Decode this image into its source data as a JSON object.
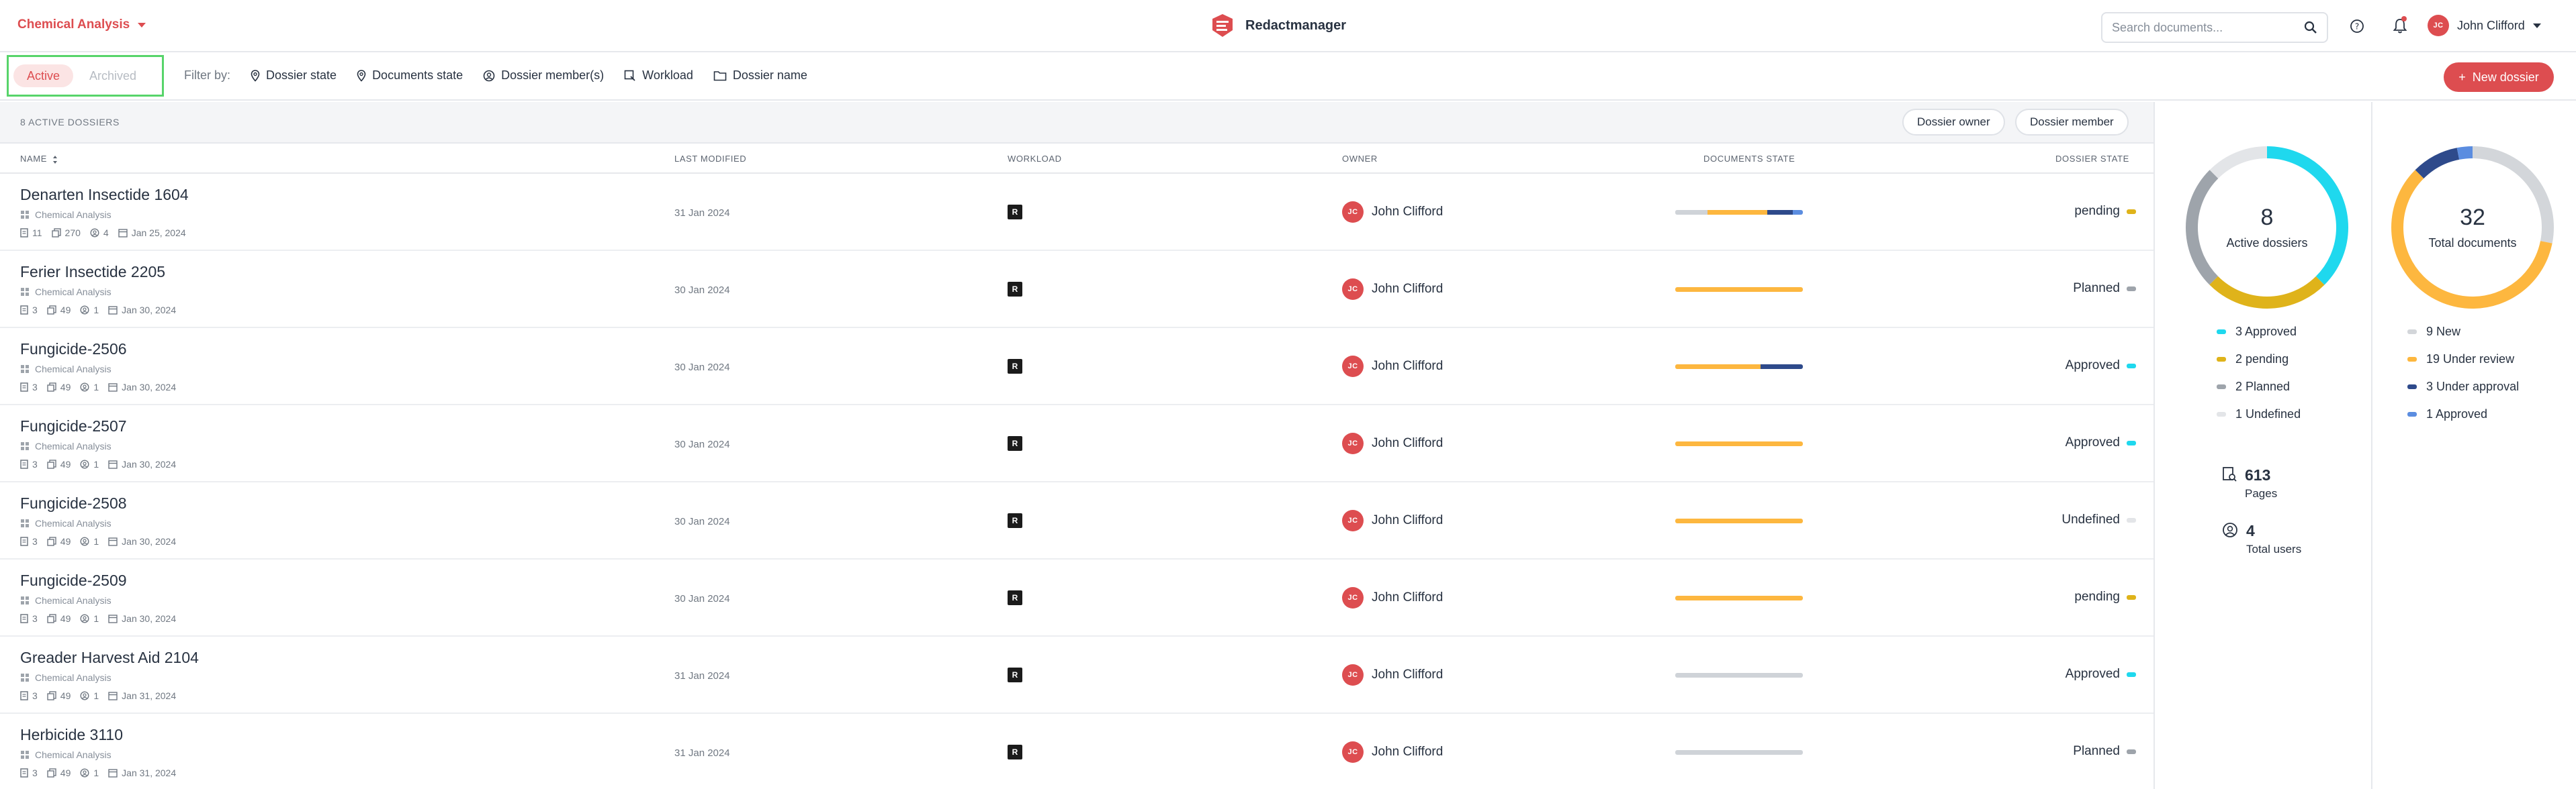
{
  "header": {
    "dossier_template": "Chemical Analysis",
    "brand": "Redactmanager",
    "search_placeholder": "Search documents...",
    "user_initials": "JC",
    "user_name": "John Clifford"
  },
  "filterbar": {
    "tabs": [
      {
        "label": "Active",
        "active": true
      },
      {
        "label": "Archived",
        "active": false
      }
    ],
    "filter_label": "Filter by:",
    "filters": [
      {
        "label": "Dossier state",
        "icon": "pin-icon"
      },
      {
        "label": "Documents state",
        "icon": "pin-icon"
      },
      {
        "label": "Dossier member(s)",
        "icon": "user-circle-icon"
      },
      {
        "label": "Workload",
        "icon": "workload-icon"
      },
      {
        "label": "Dossier name",
        "icon": "folder-icon"
      }
    ],
    "new_button": "New dossier"
  },
  "table": {
    "count_label": "8 active dossiers",
    "quick_filters": [
      "Dossier owner",
      "Dossier member"
    ],
    "columns": [
      "Name",
      "Last modified",
      "Workload",
      "Owner",
      "Documents state",
      "Dossier state"
    ],
    "rows": [
      {
        "name": "Denarten Insectide 1604",
        "template": "Chemical Analysis",
        "docs": "11",
        "pages": "270",
        "members": "4",
        "date": "Jan 25, 2024",
        "modified": "31 Jan 2024",
        "workload": "R",
        "owner": "John Clifford",
        "owner_initials": "JC",
        "doc_bar": [
          [
            0.25,
            "#cfd3d8"
          ],
          [
            0.47,
            "#fdb73f"
          ],
          [
            0.2,
            "#2e4a8b"
          ],
          [
            0.08,
            "#5b8de0"
          ]
        ],
        "state": "pending",
        "state_color": "#dfb31a"
      },
      {
        "name": "Ferier Insectide 2205",
        "template": "Chemical Analysis",
        "docs": "3",
        "pages": "49",
        "members": "1",
        "date": "Jan 30, 2024",
        "modified": "30 Jan 2024",
        "workload": "R",
        "owner": "John Clifford",
        "owner_initials": "JC",
        "doc_bar": [
          [
            1,
            "#fdb73f"
          ]
        ],
        "state": "Planned",
        "state_color": "#9ea4ab"
      },
      {
        "name": "Fungicide-2506",
        "template": "Chemical Analysis",
        "docs": "3",
        "pages": "49",
        "members": "1",
        "date": "Jan 30, 2024",
        "modified": "30 Jan 2024",
        "workload": "R",
        "owner": "John Clifford",
        "owner_initials": "JC",
        "doc_bar": [
          [
            0.67,
            "#fdb73f"
          ],
          [
            0.33,
            "#2e4a8b"
          ]
        ],
        "state": "Approved",
        "state_color": "#1fd8ee"
      },
      {
        "name": "Fungicide-2507",
        "template": "Chemical Analysis",
        "docs": "3",
        "pages": "49",
        "members": "1",
        "date": "Jan 30, 2024",
        "modified": "30 Jan 2024",
        "workload": "R",
        "owner": "John Clifford",
        "owner_initials": "JC",
        "doc_bar": [
          [
            1,
            "#fdb73f"
          ]
        ],
        "state": "Approved",
        "state_color": "#1fd8ee"
      },
      {
        "name": "Fungicide-2508",
        "template": "Chemical Analysis",
        "docs": "3",
        "pages": "49",
        "members": "1",
        "date": "Jan 30, 2024",
        "modified": "30 Jan 2024",
        "workload": "R",
        "owner": "John Clifford",
        "owner_initials": "JC",
        "doc_bar": [
          [
            1,
            "#fdb73f"
          ]
        ],
        "state": "Undefined",
        "state_color": "#e3e5e8"
      },
      {
        "name": "Fungicide-2509",
        "template": "Chemical Analysis",
        "docs": "3",
        "pages": "49",
        "members": "1",
        "date": "Jan 30, 2024",
        "modified": "30 Jan 2024",
        "workload": "R",
        "owner": "John Clifford",
        "owner_initials": "JC",
        "doc_bar": [
          [
            1,
            "#fdb73f"
          ]
        ],
        "state": "pending",
        "state_color": "#dfb31a"
      },
      {
        "name": "Greader Harvest Aid 2104",
        "template": "Chemical Analysis",
        "docs": "3",
        "pages": "49",
        "members": "1",
        "date": "Jan 31, 2024",
        "modified": "31 Jan 2024",
        "workload": "R",
        "owner": "John Clifford",
        "owner_initials": "JC",
        "doc_bar": [
          [
            1,
            "#cfd3d8"
          ]
        ],
        "state": "Approved",
        "state_color": "#1fd8ee"
      },
      {
        "name": "Herbicide 3110",
        "template": "Chemical Analysis",
        "docs": "3",
        "pages": "49",
        "members": "1",
        "date": "Jan 31, 2024",
        "modified": "31 Jan 2024",
        "workload": "R",
        "owner": "John Clifford",
        "owner_initials": "JC",
        "doc_bar": [
          [
            1,
            "#cfd3d8"
          ]
        ],
        "state": "Planned",
        "state_color": "#9ea4ab"
      }
    ]
  },
  "stats": {
    "dossiers": {
      "total": "8",
      "label": "Active dossiers",
      "segments": [
        {
          "label": "3 Approved",
          "value": 3,
          "color": "#1fd8ee"
        },
        {
          "label": "2 pending",
          "value": 2,
          "color": "#dfb31a"
        },
        {
          "label": "2 Planned",
          "value": 2,
          "color": "#9ea4ab"
        },
        {
          "label": "1 Undefined",
          "value": 1,
          "color": "#e3e5e8"
        }
      ]
    },
    "documents": {
      "total": "32",
      "label": "Total documents",
      "segments": [
        {
          "label": "9 New",
          "value": 9,
          "color": "#d3d6da"
        },
        {
          "label": "19 Under review",
          "value": 19,
          "color": "#fdb73f"
        },
        {
          "label": "3 Under approval",
          "value": 3,
          "color": "#2e4a8b"
        },
        {
          "label": "1 Approved",
          "value": 1,
          "color": "#5b8de0"
        }
      ]
    },
    "pages": {
      "value": "613",
      "label": "Pages"
    },
    "users": {
      "value": "4",
      "label": "Total users"
    }
  },
  "colors": {
    "accent": "#dd4d50",
    "highlight_box": "#57d46a"
  }
}
